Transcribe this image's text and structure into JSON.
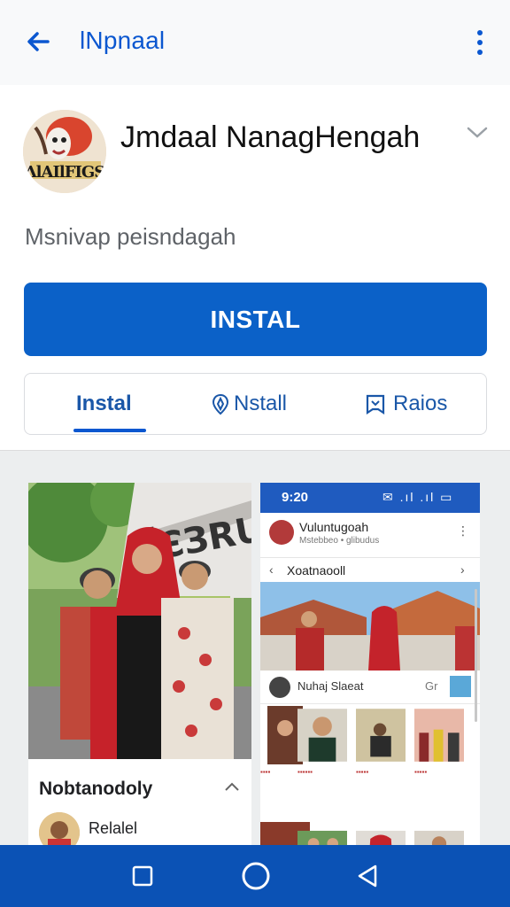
{
  "appbar": {
    "title": "lNpnaal"
  },
  "app": {
    "name": "Jmdaal NanagHengah",
    "subtitle": "Msnivap peisndagah",
    "icon_text": "ɅlAIlFIGS",
    "install_label": "INSTAL"
  },
  "tabs": [
    {
      "label": "Instal",
      "active": true
    },
    {
      "label": "Nstall",
      "icon": "pin-icon"
    },
    {
      "label": "Raios",
      "icon": "bookmark-icon"
    }
  ],
  "screenshots": {
    "left": {
      "banner_text": "ЇЄЗRUІg",
      "title": "Nobtanodoly",
      "item_label": "Relalel"
    },
    "right": {
      "status_time": "9:20",
      "status_icons": "✉ .ıl .ıl ▭",
      "profile_name": "Vuluntugoah",
      "profile_sub": "Mstebbeo • glibudus",
      "nav_title": "Xoatnaooll",
      "card_name": "Nuhaj Slaeat",
      "card_meta": "Gr"
    }
  },
  "colors": {
    "accent": "#0b57d0",
    "install_bg": "#0b61c8",
    "navbar": "#0b52b5"
  }
}
